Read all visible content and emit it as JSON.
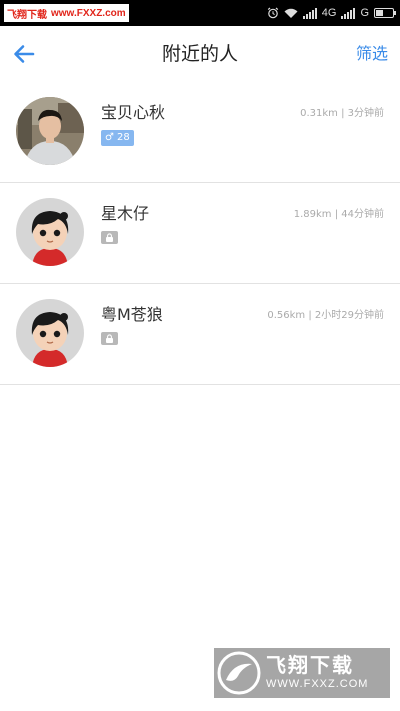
{
  "status_bar": {
    "watermark_site": "飞翔下载",
    "watermark_url": "www.FXXZ.com",
    "network_primary": "4G",
    "network_secondary": "G"
  },
  "nav": {
    "title": "附近的人",
    "filter_label": "筛选",
    "back_icon": "back-arrow-icon",
    "accent_color": "#3a8be8"
  },
  "users": [
    {
      "name": "宝贝心秋",
      "meta": "0.31km | 3分钟前",
      "badge_type": "gender",
      "gender_icon": "male-icon",
      "gender_symbol": "♂",
      "age": "28",
      "avatar_type": "photo"
    },
    {
      "name": "星木仔",
      "meta": "1.89km | 44分钟前",
      "badge_type": "lock",
      "avatar_type": "cartoon"
    },
    {
      "name": "粤M苍狼",
      "meta": "0.56km | 2小时29分钟前",
      "badge_type": "lock",
      "avatar_type": "cartoon"
    }
  ],
  "watermark_bottom": {
    "title": "飞翔下载",
    "url": "WWW.FXXZ.COM"
  }
}
